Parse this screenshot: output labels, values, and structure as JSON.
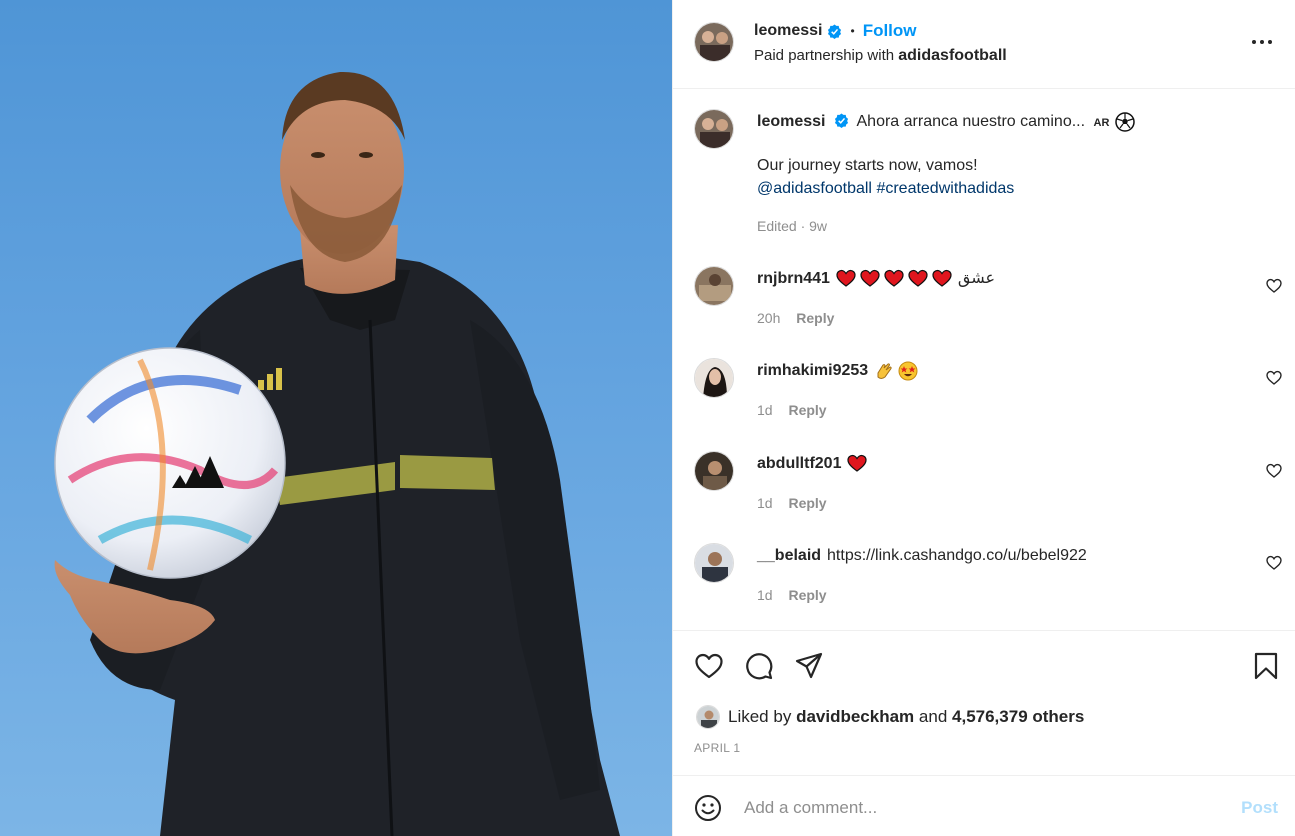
{
  "post": {
    "author": "leomessi",
    "follow_label": "Follow",
    "paid_partnership_prefix": "Paid partnership with",
    "partner": "adidasfootball"
  },
  "caption": {
    "username": "leomessi",
    "text": "Ahora arranca nuestro camino...",
    "flag": "AR",
    "second_line": "Our journey starts now, vamos!",
    "mention": "@adidasfootball",
    "hashtag": "#createdwithadidas",
    "meta": "Edited · 9w"
  },
  "comments": [
    {
      "username": "rnjbrn441",
      "text": "عشق",
      "emojis": [
        "red-heart",
        "red-heart",
        "red-heart",
        "red-heart",
        "red-heart"
      ],
      "time": "20h",
      "reply": "Reply"
    },
    {
      "username": "rimhakimi9253",
      "text": "",
      "emojis": [
        "clapping-hands",
        "star-struck"
      ],
      "time": "1d",
      "reply": "Reply"
    },
    {
      "username": "abdulltf201",
      "text": "",
      "emojis": [
        "red-heart"
      ],
      "time": "1d",
      "reply": "Reply"
    },
    {
      "username": "__belaid",
      "text": "https://link.cashandgo.co/u/bebel922",
      "emojis": [],
      "time": "1d",
      "reply": "Reply"
    }
  ],
  "likes": {
    "prefix": "Liked by",
    "by": "davidbeckham",
    "and": "and",
    "others": "4,576,379 others"
  },
  "date": "APRIL 1",
  "add_comment": {
    "placeholder": "Add a comment...",
    "post_label": "Post"
  },
  "colors": {
    "accent": "#0095f6",
    "link": "#00376b",
    "muted": "#8e8e8e",
    "post_disabled": "#b2dffc",
    "sky": "#63a3df"
  },
  "icons": [
    "verified-badge-icon",
    "more-options-icon",
    "like-icon",
    "comment-icon",
    "share-icon",
    "save-icon",
    "emoji-icon",
    "red-heart-icon",
    "clapping-hands-icon",
    "star-struck-icon",
    "soccer-ball-icon"
  ]
}
